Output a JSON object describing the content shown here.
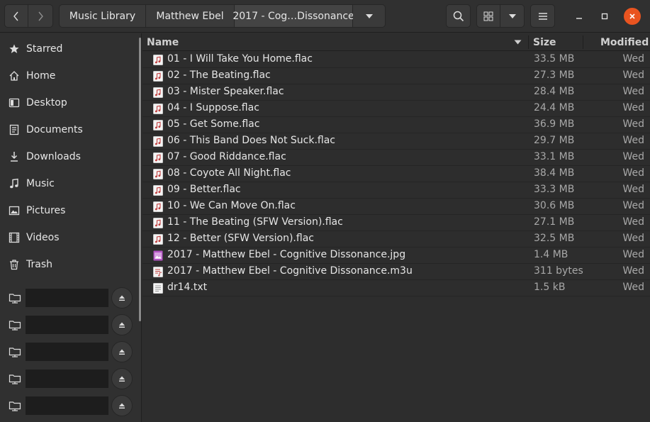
{
  "header": {
    "breadcrumbs": [
      "Music Library",
      "Matthew Ebel",
      "2017 - Cog…Dissonance"
    ]
  },
  "sidebar": {
    "items": [
      {
        "label": "Starred",
        "icon": "star-icon"
      },
      {
        "label": "Home",
        "icon": "home-icon"
      },
      {
        "label": "Desktop",
        "icon": "desktop-icon"
      },
      {
        "label": "Documents",
        "icon": "documents-icon"
      },
      {
        "label": "Downloads",
        "icon": "downloads-icon"
      },
      {
        "label": "Music",
        "icon": "music-icon"
      },
      {
        "label": "Pictures",
        "icon": "pictures-icon"
      },
      {
        "label": "Videos",
        "icon": "videos-icon"
      },
      {
        "label": "Trash",
        "icon": "trash-icon"
      }
    ],
    "volume_count": 5
  },
  "columns": {
    "name": "Name",
    "size": "Size",
    "modified": "Modified"
  },
  "files": [
    {
      "name": "01 - I Will Take You Home.flac",
      "size": "33.5 MB",
      "modified": "Wed",
      "type": "audio"
    },
    {
      "name": "02 - The Beating.flac",
      "size": "27.3 MB",
      "modified": "Wed",
      "type": "audio"
    },
    {
      "name": "03 - Mister Speaker.flac",
      "size": "28.4 MB",
      "modified": "Wed",
      "type": "audio"
    },
    {
      "name": "04 - I Suppose.flac",
      "size": "24.4 MB",
      "modified": "Wed",
      "type": "audio"
    },
    {
      "name": "05 - Get Some.flac",
      "size": "36.9 MB",
      "modified": "Wed",
      "type": "audio"
    },
    {
      "name": "06 - This Band Does Not Suck.flac",
      "size": "29.7 MB",
      "modified": "Wed",
      "type": "audio"
    },
    {
      "name": "07 - Good Riddance.flac",
      "size": "33.1 MB",
      "modified": "Wed",
      "type": "audio"
    },
    {
      "name": "08 - Coyote All Night.flac",
      "size": "38.4 MB",
      "modified": "Wed",
      "type": "audio"
    },
    {
      "name": "09 - Better.flac",
      "size": "33.3 MB",
      "modified": "Wed",
      "type": "audio"
    },
    {
      "name": "10 - We Can Move On.flac",
      "size": "30.6 MB",
      "modified": "Wed",
      "type": "audio"
    },
    {
      "name": "11 - The Beating (SFW Version).flac",
      "size": "27.1 MB",
      "modified": "Wed",
      "type": "audio"
    },
    {
      "name": "12 - Better (SFW Version).flac",
      "size": "32.5 MB",
      "modified": "Wed",
      "type": "audio"
    },
    {
      "name": "2017 - Matthew Ebel - Cognitive Dissonance.jpg",
      "size": "1.4 MB",
      "modified": "Wed",
      "type": "image"
    },
    {
      "name": "2017 - Matthew Ebel - Cognitive Dissonance.m3u",
      "size": "311 bytes",
      "modified": "Wed",
      "type": "playlist"
    },
    {
      "name": "dr14.txt",
      "size": "1.5 kB",
      "modified": "Wed",
      "type": "text"
    }
  ],
  "colors": {
    "accent": "#e95420",
    "image_icon": "#b455c4",
    "audio_icon": "#c04040"
  }
}
